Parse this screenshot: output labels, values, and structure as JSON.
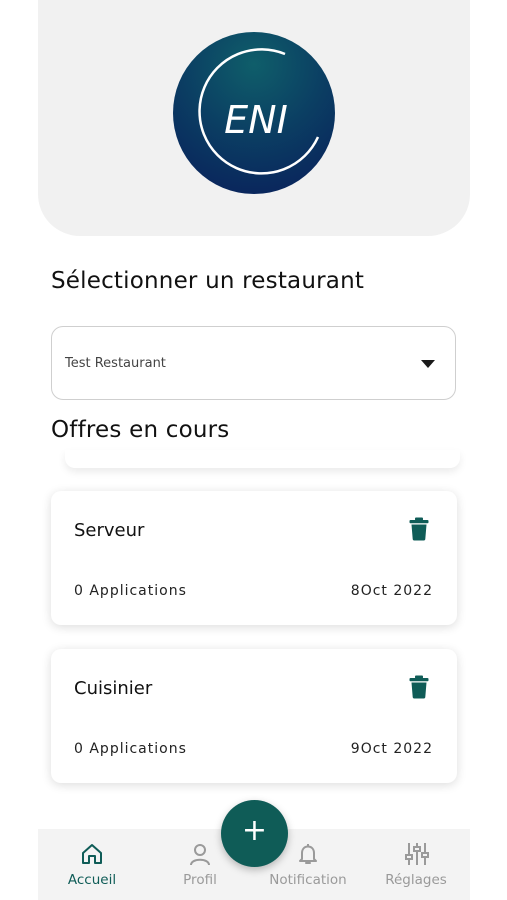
{
  "header": {
    "logo_text": "ENI"
  },
  "restaurant_select": {
    "title": "Sélectionner un restaurant",
    "selected": "Test Restaurant"
  },
  "offers": {
    "title": "Offres en cours",
    "items": [
      {
        "title": "Serveur",
        "applications": "0 Applications",
        "date": "8Oct 2022"
      },
      {
        "title": "Cuisinier",
        "applications": "0 Applications",
        "date": "9Oct 2022"
      }
    ]
  },
  "fab": {
    "label": "+"
  },
  "bottom_nav": {
    "items": [
      {
        "label": "Accueil",
        "icon": "home-icon",
        "active": true
      },
      {
        "label": "Profil",
        "icon": "user-icon",
        "active": false
      },
      {
        "label": "Notification",
        "icon": "bell-icon",
        "active": false
      },
      {
        "label": "Réglages",
        "icon": "sliders-icon",
        "active": false
      }
    ]
  },
  "colors": {
    "accent": "#0f5c57",
    "header_bg": "#f1f1f1",
    "logo_dark": "#091d5a",
    "inactive": "#9a9a9a"
  }
}
